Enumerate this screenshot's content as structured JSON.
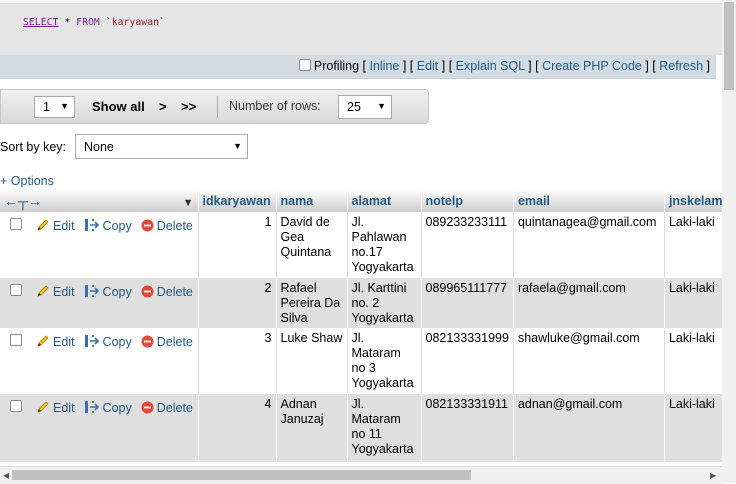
{
  "sql": {
    "select_kw": "SELECT",
    "star": "*",
    "from_kw": "FROM",
    "table_literal": "`karyawan`"
  },
  "toolbar": {
    "profiling": "Profiling",
    "inline": "Inline",
    "edit": "Edit",
    "explain": "Explain SQL",
    "create_php": "Create PHP Code",
    "refresh": "Refresh"
  },
  "nav": {
    "page": "1",
    "show_all": "Show all",
    "next": ">",
    "last": ">>",
    "rows_label": "Number of rows:",
    "rows_value": "25"
  },
  "sort": {
    "label": "Sort by key:",
    "value": "None"
  },
  "options_label": "+ Options",
  "columns": [
    "idkaryawan",
    "nama",
    "alamat",
    "notelp",
    "email",
    "jnskelam"
  ],
  "actions": {
    "edit": "Edit",
    "copy": "Copy",
    "delete": "Delete"
  },
  "rows": [
    {
      "id": "1",
      "nama": "David de Gea Quintana",
      "alamat": "Jl. Pahlawan no.17 Yogyakarta",
      "notelp": "089233233111",
      "email": "quintanagea@gmail.com",
      "jk": "Laki-laki"
    },
    {
      "id": "2",
      "nama": "Rafael Pereira Da Silva",
      "alamat": "Jl. Karttini no. 2 Yogyakarta",
      "notelp": "089965111777",
      "email": "rafaela@gmail.com",
      "jk": "Laki-laki"
    },
    {
      "id": "3",
      "nama": "Luke Shaw",
      "alamat": "Jl. Mataram no 3 Yogyakarta",
      "notelp": "082133331999",
      "email": "shawluke@gmail.com",
      "jk": "Laki-laki"
    },
    {
      "id": "4",
      "nama": "Adnan Januzaj",
      "alamat": "Jl. Mataram no 11 Yogyakarta",
      "notelp": "082133331911",
      "email": "adnan@gmail.com",
      "jk": "Laki-laki"
    }
  ]
}
